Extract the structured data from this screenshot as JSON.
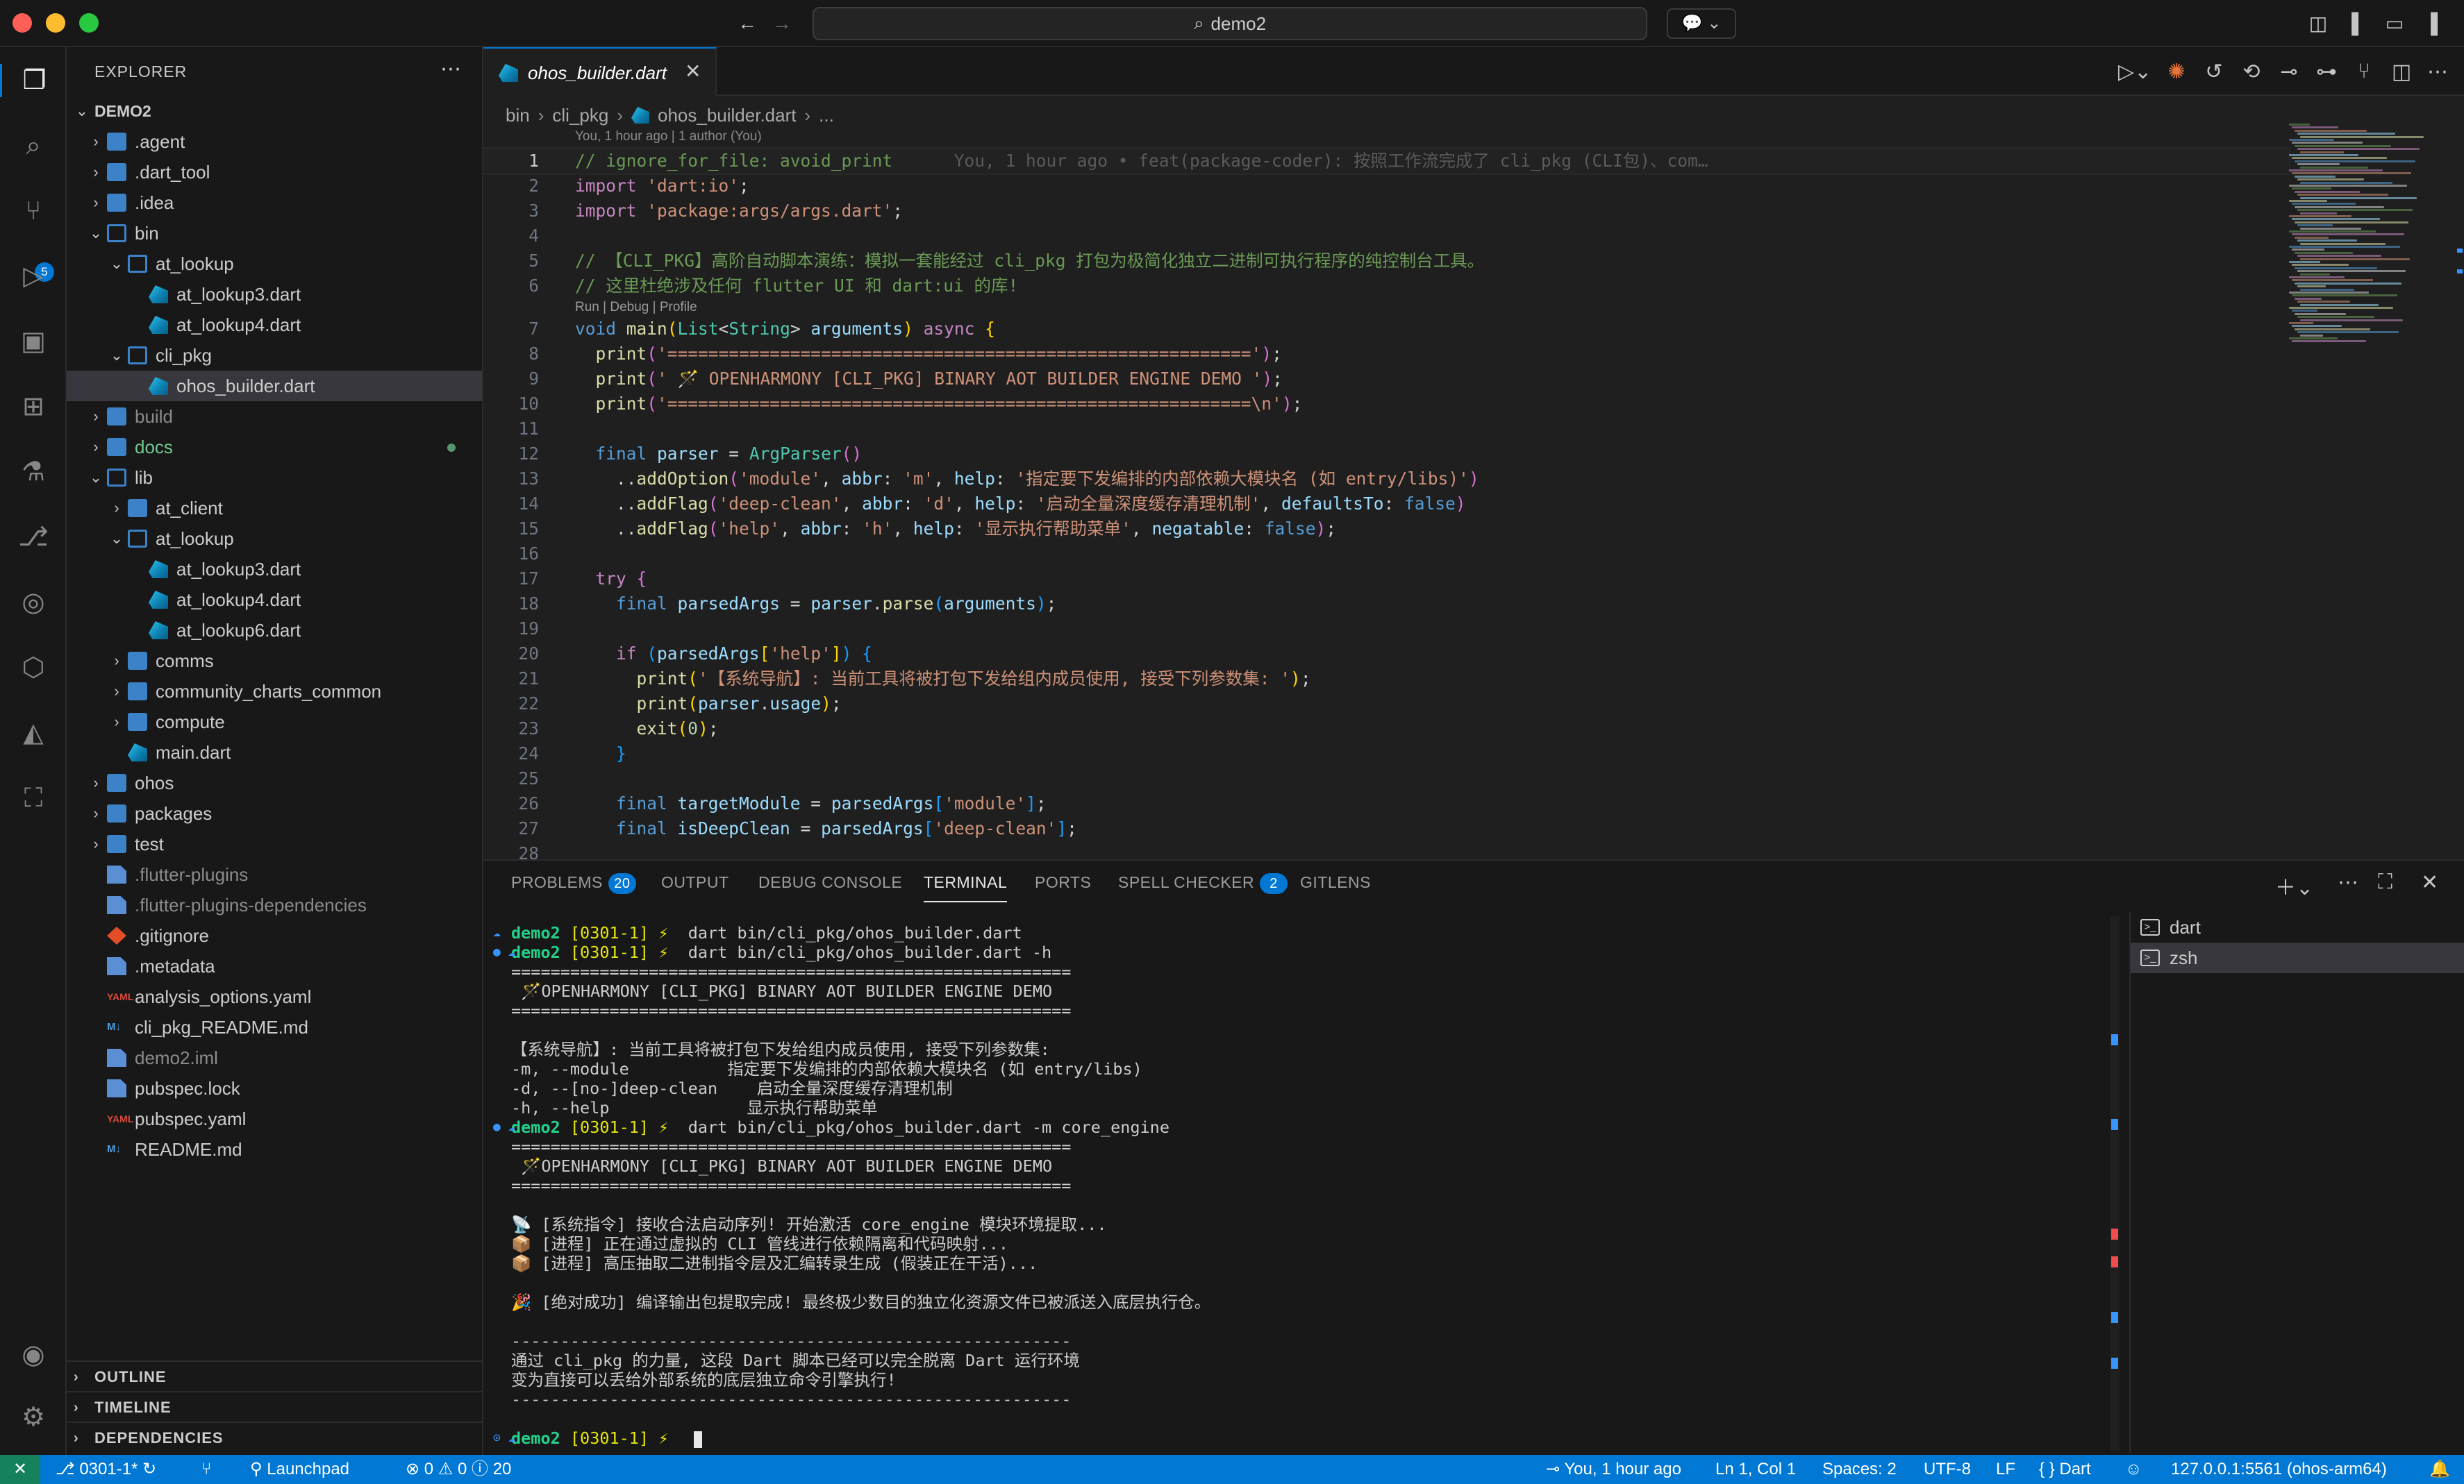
{
  "window": {
    "title": "demo2"
  },
  "explorer": {
    "title": "EXPLORER",
    "root": "DEMO2",
    "items": [
      {
        "label": ".agent",
        "type": "folder",
        "depth": 0,
        "open": false
      },
      {
        "label": ".dart_tool",
        "type": "folder",
        "depth": 0,
        "open": false
      },
      {
        "label": ".idea",
        "type": "folder",
        "depth": 0,
        "open": false
      },
      {
        "label": "bin",
        "type": "folder",
        "depth": 0,
        "open": true
      },
      {
        "label": "at_lookup",
        "type": "folder",
        "depth": 1,
        "open": true
      },
      {
        "label": "at_lookup3.dart",
        "type": "dart",
        "depth": 2
      },
      {
        "label": "at_lookup4.dart",
        "type": "dart",
        "depth": 2
      },
      {
        "label": "cli_pkg",
        "type": "folder",
        "depth": 1,
        "open": true
      },
      {
        "label": "ohos_builder.dart",
        "type": "dart",
        "depth": 2,
        "selected": true
      },
      {
        "label": "build",
        "type": "folder",
        "depth": 0,
        "open": false,
        "ignored": true
      },
      {
        "label": "docs",
        "type": "folder",
        "depth": 0,
        "open": false,
        "modified": true
      },
      {
        "label": "lib",
        "type": "folder",
        "depth": 0,
        "open": true
      },
      {
        "label": "at_client",
        "type": "folder",
        "depth": 1,
        "open": false
      },
      {
        "label": "at_lookup",
        "type": "folder",
        "depth": 1,
        "open": true
      },
      {
        "label": "at_lookup3.dart",
        "type": "dart",
        "depth": 2
      },
      {
        "label": "at_lookup4.dart",
        "type": "dart",
        "depth": 2
      },
      {
        "label": "at_lookup6.dart",
        "type": "dart",
        "depth": 2
      },
      {
        "label": "comms",
        "type": "folder",
        "depth": 1,
        "open": false
      },
      {
        "label": "community_charts_common",
        "type": "folder",
        "depth": 1,
        "open": false
      },
      {
        "label": "compute",
        "type": "folder",
        "depth": 1,
        "open": false
      },
      {
        "label": "main.dart",
        "type": "dart",
        "depth": 1
      },
      {
        "label": "ohos",
        "type": "folder",
        "depth": 0,
        "open": false
      },
      {
        "label": "packages",
        "type": "folder",
        "depth": 0,
        "open": false
      },
      {
        "label": "test",
        "type": "folder",
        "depth": 0,
        "open": false
      },
      {
        "label": ".flutter-plugins",
        "type": "file",
        "depth": 0,
        "ignored": true
      },
      {
        "label": ".flutter-plugins-dependencies",
        "type": "file",
        "depth": 0,
        "ignored": true
      },
      {
        "label": ".gitignore",
        "type": "git",
        "depth": 0
      },
      {
        "label": ".metadata",
        "type": "file",
        "depth": 0
      },
      {
        "label": "analysis_options.yaml",
        "type": "yaml",
        "depth": 0
      },
      {
        "label": "cli_pkg_README.md",
        "type": "md",
        "depth": 0
      },
      {
        "label": "demo2.iml",
        "type": "file",
        "depth": 0,
        "ignored": true
      },
      {
        "label": "pubspec.lock",
        "type": "file",
        "depth": 0
      },
      {
        "label": "pubspec.yaml",
        "type": "yaml",
        "depth": 0
      },
      {
        "label": "README.md",
        "type": "md",
        "depth": 0
      }
    ],
    "sections": [
      "OUTLINE",
      "TIMELINE",
      "DEPENDENCIES"
    ]
  },
  "activity": {
    "scm_badge": "5"
  },
  "editor": {
    "tab_label": "ohos_builder.dart",
    "breadcrumbs": [
      "bin",
      "cli_pkg",
      "ohos_builder.dart",
      "..."
    ],
    "blame_header": "You, 1 hour ago | 1 author (You)",
    "codelens": "Run | Debug | Profile",
    "current_line": 1,
    "lines": [
      [
        [
          "c-cm",
          "// ignore_for_file: avoid_print"
        ],
        [
          "c-gh",
          "      You, 1 hour ago • feat(package-coder): 按照工作流完成了 cli_pkg (CLI包)、com…"
        ]
      ],
      [
        [
          "c-kw",
          "import "
        ],
        [
          "c-st",
          "'dart:io'"
        ],
        [
          "c-tx",
          ";"
        ]
      ],
      [
        [
          "c-kw",
          "import "
        ],
        [
          "c-st",
          "'package:args/args.dart'"
        ],
        [
          "c-tx",
          ";"
        ]
      ],
      [],
      [
        [
          "c-cm",
          "// 【CLI_PKG】高阶自动脚本演练：模拟一套能经过 cli_pkg 打包为极简化独立二进制可执行程序的纯控制台工具。"
        ]
      ],
      [
        [
          "c-cm",
          "// 这里杜绝涉及任何 flutter UI 和 dart:ui 的库!"
        ]
      ],
      [
        [
          "c-bl",
          "void "
        ],
        [
          "c-fn",
          "main"
        ],
        [
          "c-br1",
          "("
        ],
        [
          "c-ty",
          "List"
        ],
        [
          "c-tx",
          "<"
        ],
        [
          "c-ty",
          "String"
        ],
        [
          "c-tx",
          "> "
        ],
        [
          "c-vr",
          "arguments"
        ],
        [
          "c-br1",
          ")"
        ],
        [
          "c-kw",
          " async "
        ],
        [
          "c-br1",
          "{"
        ]
      ],
      [
        [
          "c-tx",
          "  "
        ],
        [
          "c-fn",
          "print"
        ],
        [
          "c-br2",
          "("
        ],
        [
          "c-st",
          "'========================================================='"
        ],
        [
          "c-br2",
          ")"
        ],
        [
          "c-tx",
          ";"
        ]
      ],
      [
        [
          "c-tx",
          "  "
        ],
        [
          "c-fn",
          "print"
        ],
        [
          "c-br2",
          "("
        ],
        [
          "c-st",
          "' 🪄 OPENHARMONY [CLI_PKG] BINARY AOT BUILDER ENGINE DEMO '"
        ],
        [
          "c-br2",
          ")"
        ],
        [
          "c-tx",
          ";"
        ]
      ],
      [
        [
          "c-tx",
          "  "
        ],
        [
          "c-fn",
          "print"
        ],
        [
          "c-br2",
          "("
        ],
        [
          "c-st",
          "'=========================================================\\n'"
        ],
        [
          "c-br2",
          ")"
        ],
        [
          "c-tx",
          ";"
        ]
      ],
      [],
      [
        [
          "c-tx",
          "  "
        ],
        [
          "c-bl",
          "final "
        ],
        [
          "c-vr",
          "parser"
        ],
        [
          "c-tx",
          " = "
        ],
        [
          "c-ty",
          "ArgParser"
        ],
        [
          "c-br2",
          "()"
        ]
      ],
      [
        [
          "c-tx",
          "    .."
        ],
        [
          "c-fn",
          "addOption"
        ],
        [
          "c-br2",
          "("
        ],
        [
          "c-st",
          "'module'"
        ],
        [
          "c-tx",
          ", "
        ],
        [
          "c-vr",
          "abbr"
        ],
        [
          "c-tx",
          ": "
        ],
        [
          "c-st",
          "'m'"
        ],
        [
          "c-tx",
          ", "
        ],
        [
          "c-vr",
          "help"
        ],
        [
          "c-tx",
          ": "
        ],
        [
          "c-st",
          "'指定要下发编排的内部依赖大模块名 (如 entry/libs)'"
        ],
        [
          "c-br2",
          ")"
        ]
      ],
      [
        [
          "c-tx",
          "    .."
        ],
        [
          "c-fn",
          "addFlag"
        ],
        [
          "c-br2",
          "("
        ],
        [
          "c-st",
          "'deep-clean'"
        ],
        [
          "c-tx",
          ", "
        ],
        [
          "c-vr",
          "abbr"
        ],
        [
          "c-tx",
          ": "
        ],
        [
          "c-st",
          "'d'"
        ],
        [
          "c-tx",
          ", "
        ],
        [
          "c-vr",
          "help"
        ],
        [
          "c-tx",
          ": "
        ],
        [
          "c-st",
          "'启动全量深度缓存清理机制'"
        ],
        [
          "c-tx",
          ", "
        ],
        [
          "c-vr",
          "defaultsTo"
        ],
        [
          "c-tx",
          ": "
        ],
        [
          "c-bl",
          "false"
        ],
        [
          "c-br2",
          ")"
        ]
      ],
      [
        [
          "c-tx",
          "    .."
        ],
        [
          "c-fn",
          "addFlag"
        ],
        [
          "c-br2",
          "("
        ],
        [
          "c-st",
          "'help'"
        ],
        [
          "c-tx",
          ", "
        ],
        [
          "c-vr",
          "abbr"
        ],
        [
          "c-tx",
          ": "
        ],
        [
          "c-st",
          "'h'"
        ],
        [
          "c-tx",
          ", "
        ],
        [
          "c-vr",
          "help"
        ],
        [
          "c-tx",
          ": "
        ],
        [
          "c-st",
          "'显示执行帮助菜单'"
        ],
        [
          "c-tx",
          ", "
        ],
        [
          "c-vr",
          "negatable"
        ],
        [
          "c-tx",
          ": "
        ],
        [
          "c-bl",
          "false"
        ],
        [
          "c-br2",
          ")"
        ],
        [
          "c-tx",
          ";"
        ]
      ],
      [],
      [
        [
          "c-tx",
          "  "
        ],
        [
          "c-kw",
          "try "
        ],
        [
          "c-br2",
          "{"
        ]
      ],
      [
        [
          "c-tx",
          "    "
        ],
        [
          "c-bl",
          "final "
        ],
        [
          "c-vr",
          "parsedArgs"
        ],
        [
          "c-tx",
          " = "
        ],
        [
          "c-vr",
          "parser"
        ],
        [
          "c-tx",
          "."
        ],
        [
          "c-fn",
          "parse"
        ],
        [
          "c-br3",
          "("
        ],
        [
          "c-vr",
          "arguments"
        ],
        [
          "c-br3",
          ")"
        ],
        [
          "c-tx",
          ";"
        ]
      ],
      [],
      [
        [
          "c-tx",
          "    "
        ],
        [
          "c-kw",
          "if "
        ],
        [
          "c-br3",
          "("
        ],
        [
          "c-vr",
          "parsedArgs"
        ],
        [
          "c-br1",
          "["
        ],
        [
          "c-st",
          "'help'"
        ],
        [
          "c-br1",
          "]"
        ],
        [
          "c-br3",
          ")"
        ],
        [
          "c-br3",
          " {"
        ]
      ],
      [
        [
          "c-tx",
          "      "
        ],
        [
          "c-fn",
          "print"
        ],
        [
          "c-br1",
          "("
        ],
        [
          "c-st",
          "'【系统导航】: 当前工具将被打包下发给组内成员使用, 接受下列参数集: '"
        ],
        [
          "c-br1",
          ")"
        ],
        [
          "c-tx",
          ";"
        ]
      ],
      [
        [
          "c-tx",
          "      "
        ],
        [
          "c-fn",
          "print"
        ],
        [
          "c-br1",
          "("
        ],
        [
          "c-vr",
          "parser"
        ],
        [
          "c-tx",
          "."
        ],
        [
          "c-vr",
          "usage"
        ],
        [
          "c-br1",
          ")"
        ],
        [
          "c-tx",
          ";"
        ]
      ],
      [
        [
          "c-tx",
          "      "
        ],
        [
          "c-fn",
          "exit"
        ],
        [
          "c-br1",
          "("
        ],
        [
          "c-nm",
          "0"
        ],
        [
          "c-br1",
          ")"
        ],
        [
          "c-tx",
          ";"
        ]
      ],
      [
        [
          "c-tx",
          "    "
        ],
        [
          "c-br3",
          "}"
        ]
      ],
      [],
      [
        [
          "c-tx",
          "    "
        ],
        [
          "c-bl",
          "final "
        ],
        [
          "c-vr",
          "targetModule"
        ],
        [
          "c-tx",
          " = "
        ],
        [
          "c-vr",
          "parsedArgs"
        ],
        [
          "c-br3",
          "["
        ],
        [
          "c-st",
          "'module'"
        ],
        [
          "c-br3",
          "]"
        ],
        [
          "c-tx",
          ";"
        ]
      ],
      [
        [
          "c-tx",
          "    "
        ],
        [
          "c-bl",
          "final "
        ],
        [
          "c-vr",
          "isDeepClean"
        ],
        [
          "c-tx",
          " = "
        ],
        [
          "c-vr",
          "parsedArgs"
        ],
        [
          "c-br3",
          "["
        ],
        [
          "c-st",
          "'deep-clean'"
        ],
        [
          "c-br3",
          "]"
        ],
        [
          "c-tx",
          ";"
        ]
      ],
      []
    ]
  },
  "panel": {
    "tabs": [
      {
        "label": "PROBLEMS",
        "badge": "20"
      },
      {
        "label": "OUTPUT"
      },
      {
        "label": "DEBUG CONSOLE"
      },
      {
        "label": "TERMINAL",
        "active": true
      },
      {
        "label": "PORTS"
      },
      {
        "label": "SPELL CHECKER",
        "badge": "2"
      },
      {
        "label": "GITLENS"
      }
    ],
    "terminal_lines": [
      {
        "mark": "☁",
        "prompt": "demo2",
        "branch": "[0301-1]",
        "cmd": "dart bin/cli_pkg/ohos_builder.dart"
      },
      {
        "mark": "● ☁",
        "prompt": "demo2",
        "branch": "[0301-1]",
        "cmd": "dart bin/cli_pkg/ohos_builder.dart -h"
      },
      {
        "text": "========================================================="
      },
      {
        "text": " 🪄OPENHARMONY [CLI_PKG] BINARY AOT BUILDER ENGINE DEMO"
      },
      {
        "text": "========================================================="
      },
      {
        "text": ""
      },
      {
        "text": "【系统导航】: 当前工具将被打包下发给组内成员使用, 接受下列参数集:"
      },
      {
        "text": "-m, --module          指定要下发编排的内部依赖大模块名 (如 entry/libs)"
      },
      {
        "text": "-d, --[no-]deep-clean    启动全量深度缓存清理机制"
      },
      {
        "text": "-h, --help              显示执行帮助菜单"
      },
      {
        "mark": "● ☁",
        "prompt": "demo2",
        "branch": "[0301-1]",
        "cmd": "dart bin/cli_pkg/ohos_builder.dart -m core_engine"
      },
      {
        "text": "========================================================="
      },
      {
        "text": " 🪄OPENHARMONY [CLI_PKG] BINARY AOT BUILDER ENGINE DEMO"
      },
      {
        "text": "========================================================="
      },
      {
        "text": ""
      },
      {
        "text": "📡 [系统指令] 接收合法启动序列! 开始激活 core_engine 模块环境提取..."
      },
      {
        "text": "📦 [进程] 正在通过虚拟的 CLI 管线进行依赖隔离和代码映射..."
      },
      {
        "text": "📦 [进程] 高压抽取二进制指令层及汇编转录生成 (假装正在干活)..."
      },
      {
        "text": ""
      },
      {
        "text": "🎉 [绝对成功] 编译输出包提取完成! 最终极少数目的独立化资源文件已被派送入底层执行仓。"
      },
      {
        "text": ""
      },
      {
        "text": "---------------------------------------------------------"
      },
      {
        "text": "通过 cli_pkg 的力量, 这段 Dart 脚本已经可以完全脱离 Dart 运行环境"
      },
      {
        "text": "变为直接可以丢给外部系统的底层独立命令引擎执行!"
      },
      {
        "text": "---------------------------------------------------------"
      },
      {
        "text": ""
      },
      {
        "mark": "⊙ ☁",
        "prompt": "demo2",
        "branch": "[0301-1]",
        "cmd": "",
        "cursor": true
      }
    ],
    "terminal_list": [
      {
        "label": "dart"
      },
      {
        "label": "zsh",
        "selected": true
      }
    ]
  },
  "status": {
    "remote": "✕",
    "branch": "0301-1*",
    "launchpad": "Launchpad",
    "errors": "0",
    "warnings": "0",
    "infos": "20",
    "blame": "You, 1 hour ago",
    "position": "Ln 1, Col 1",
    "spaces": "Spaces: 2",
    "encoding": "UTF-8",
    "eol": "LF",
    "language": "Dart",
    "device": "127.0.0.1:5561 (ohos-arm64)"
  }
}
